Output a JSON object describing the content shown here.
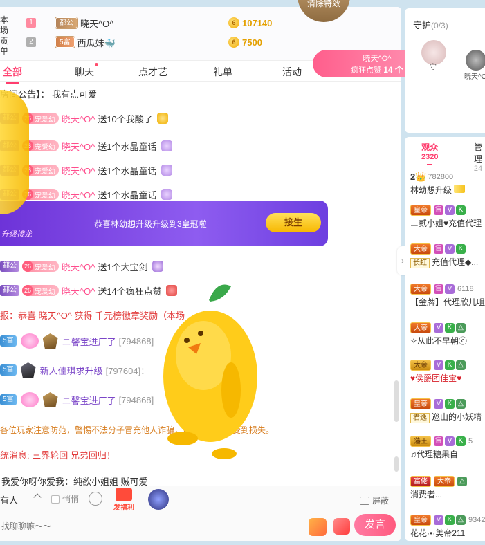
{
  "rank_panel": {
    "side_tag": "本场\n贡单",
    "rows": [
      {
        "num": "1",
        "num_color": "#ff8aa0",
        "badge": "都公",
        "name": "晓天^O^",
        "coin_icon": "6",
        "value": "107140"
      },
      {
        "num": "2",
        "num_color": "#b0b0b0",
        "badge": "5富",
        "name": "西瓜妹🐳",
        "coin_icon": "6",
        "value": "7500"
      }
    ]
  },
  "clear_effects": "清除特效",
  "effect_banner": {
    "user": "晓天^O^",
    "text": "疯狂点赞",
    "count": "14 个"
  },
  "tabs": [
    {
      "label": "全部",
      "active": true,
      "dot": false
    },
    {
      "label": "聊天",
      "active": false,
      "dot": true
    },
    {
      "label": "点才艺",
      "active": false,
      "dot": false
    },
    {
      "label": "礼单",
      "active": false,
      "dot": false
    },
    {
      "label": "活动",
      "active": false,
      "dot": false
    }
  ],
  "announcement": "房间公告】： 我有点可爱",
  "messages": [
    {
      "badge": "都公",
      "fan_lv": "26",
      "fan_name": "宠爱幼",
      "user": "晓天^O^",
      "text": "送10个我酸了",
      "icon": "gift-icon"
    },
    {
      "badge": "都公",
      "fan_lv": "26",
      "fan_name": "宠爱幼",
      "user": "晓天^O^",
      "text": "送1个水晶童话",
      "icon": "gift-icon"
    },
    {
      "badge": "都公",
      "fan_lv": "26",
      "fan_name": "宠爱幼",
      "user": "晓天^O^",
      "text": "送1个水晶童话",
      "icon": "gift-icon"
    },
    {
      "badge": "都公",
      "fan_lv": "26",
      "fan_name": "宠爱幼",
      "user": "晓天^O^",
      "text": "送1个水晶童话",
      "icon": "gift-icon"
    },
    {
      "badge": "都公",
      "fan_lv": "26",
      "fan_name": "宠爱幼",
      "user": "晓天^O^",
      "text": "送1个大宝剑",
      "icon": "gift-icon"
    },
    {
      "badge": "都公",
      "fan_lv": "26",
      "fan_name": "宠爱幼",
      "user": "晓天^O^",
      "text": "送14个疯狂点赞",
      "icon": "gift-icon"
    }
  ],
  "upgrade_banner": {
    "text": "恭喜林幼想升级升级到3皇冠啦",
    "button": "接生",
    "sub": "升级接龙"
  },
  "system_msgs": {
    "broadcast": "报：恭喜 晓天^O^ 获得 千元榜徽章奖励（本场",
    "enter": [
      {
        "wealth": "5富",
        "user": "ニ馨宝进厂了",
        "id": "[794868]"
      },
      {
        "wealth": "5富",
        "user": "新人佳琪求升级",
        "id": "[797604]："
      },
      {
        "wealth": "5富",
        "user": "ニ馨宝进厂了",
        "id": "[794868]"
      }
    ],
    "warning": "各位玩家注意防范，警惕不法分子冒充他人诈骗，以免个人财产受到损失。",
    "system": "统消息: 三界轮回 兄弟回归！",
    "last_chat": "我爱你呀你爱我：纯欲小姐姐 贼可爱"
  },
  "input_bar": {
    "recipient": "有人",
    "whisper": "悄悄",
    "fuli": "发福利",
    "shield": "屏蔽",
    "placeholder": "找聊聊嘛～～",
    "send": "发言"
  },
  "guard": {
    "title": "守护",
    "count": "(0/3)",
    "user1": "守",
    "user2": "晓天^O^"
  },
  "audience": {
    "tabs": [
      {
        "label": "观众",
        "count": "2320",
        "active": true
      },
      {
        "label": "管理",
        "count": "24",
        "active": false
      }
    ],
    "list": [
      {
        "rank": "2👑",
        "num": "782800",
        "name": "林幼想升级",
        "style": "crown"
      },
      {
        "rank": "皇帝",
        "icons": [
          "售",
          "V",
          "K"
        ],
        "num": "",
        "name": "ニ贰小姐♥充值代理",
        "style": "orange"
      },
      {
        "rank": "大帝",
        "icons": [
          "售",
          "V",
          "K"
        ],
        "num": "",
        "badge": "长虹",
        "name": "充值代理◆...",
        "style": "orange"
      },
      {
        "rank": "大帝",
        "icons": [
          "售",
          "V"
        ],
        "num": "6118",
        "name": "【金牌】代理欣儿咀",
        "style": "orange"
      },
      {
        "rank": "大帝",
        "icons": [
          "V",
          "K",
          "△"
        ],
        "num": "",
        "name": "✧从此不早朝ⓒ",
        "style": "orange"
      },
      {
        "rank": "大帝",
        "icons": [
          "V",
          "K",
          "△"
        ],
        "num": "",
        "name": "♥侯爵团佳宝♥",
        "style": "gold",
        "red": true
      },
      {
        "rank": "皇帝",
        "icons": [
          "V",
          "K",
          "△"
        ],
        "num": "",
        "badge": "君逸",
        "name": "巡山的小妖精",
        "style": "orange"
      },
      {
        "rank": "藩王",
        "icons": [
          "售",
          "V",
          "K"
        ],
        "num": "5",
        "name": "♫代理糖果自",
        "style": "gold"
      },
      {
        "rank": "富佬",
        "rank2": "大帝",
        "icons": [
          "△"
        ],
        "num": "",
        "name": "消费者...",
        "style": "red"
      },
      {
        "rank": "皇帝",
        "icons": [
          "V",
          "K",
          "△"
        ],
        "num": "9342",
        "name": "花花·•·美帝211",
        "style": "orange"
      }
    ]
  },
  "colors": {
    "accent": "#ff3d6e",
    "banner": "#7a45e0",
    "send": "#ff6b8f"
  }
}
